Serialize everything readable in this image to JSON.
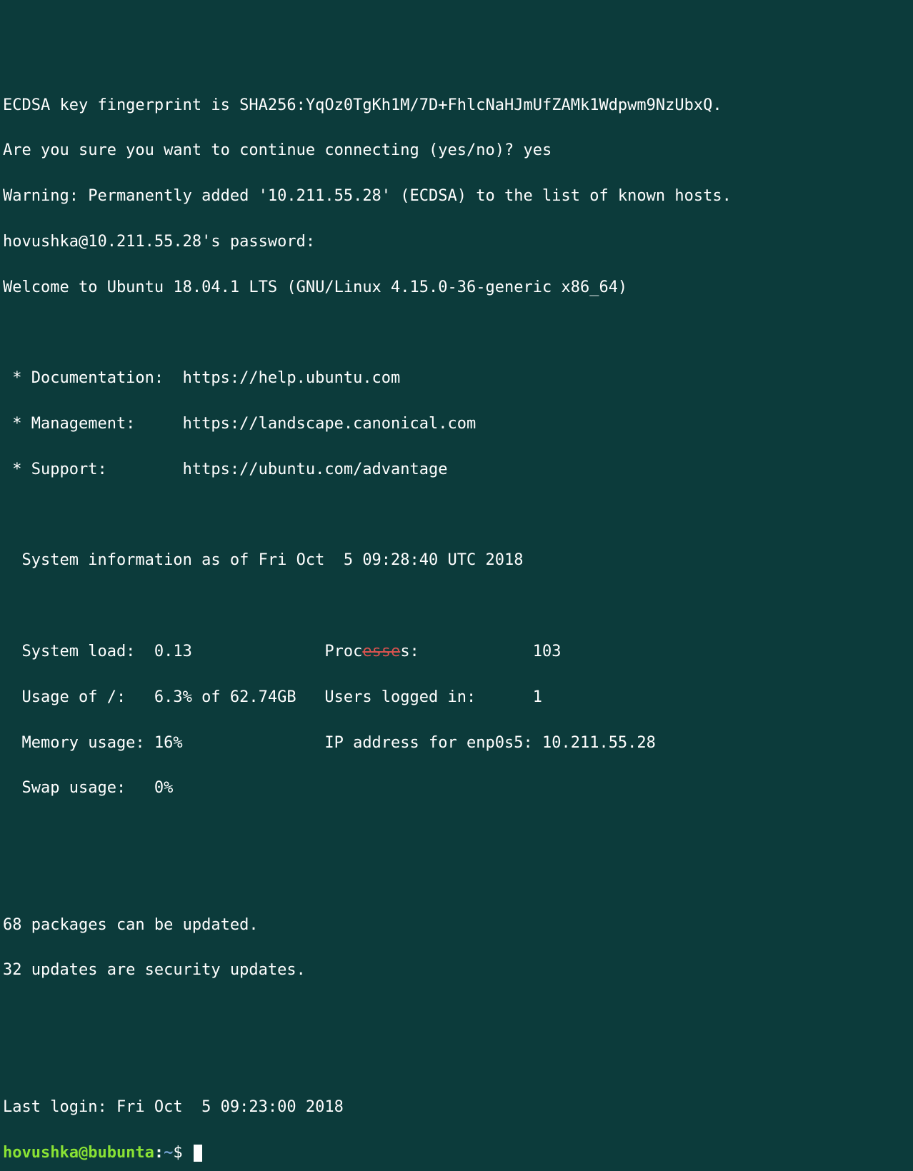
{
  "lines": {
    "ecdsa": "ECDSA key fingerprint is SHA256:YqOz0TgKh1M/7D+FhlcNaHJmUfZAMk1Wdpwm9NzUbxQ.",
    "confirm": "Are you sure you want to continue connecting (yes/no)? yes",
    "warning": "Warning: Permanently added '10.211.55.28' (ECDSA) to the list of known hosts.",
    "password": "hovushka@10.211.55.28's password:",
    "welcome": "Welcome to Ubuntu 18.04.1 LTS (GNU/Linux 4.15.0-36-generic x86_64)"
  },
  "motd": {
    "doc": " * Documentation:  https://help.ubuntu.com",
    "mgmt": " * Management:     https://landscape.canonical.com",
    "support": " * Support:        https://ubuntu.com/advantage"
  },
  "sysinfo_header": "  System information as of Fri Oct  5 09:28:40 UTC 2018",
  "sysinfo": {
    "left1": "  System load:  0.13              ",
    "right1a": "Proc",
    "right1_strike": "esse",
    "right1b": "s:            103",
    "row2": "  Usage of /:   6.3% of 62.74GB   Users logged in:      1",
    "row3": "  Memory usage: 16%               IP address for enp0s5: 10.211.55.28",
    "row4": "  Swap usage:   0%"
  },
  "updates": {
    "l1": "68 packages can be updated.",
    "l2": "32 updates are security updates."
  },
  "lastlogin": "Last login: Fri Oct  5 09:23:00 2018",
  "prompt": {
    "userhost": "hovushka@bubunta",
    "colon": ":",
    "path": "~",
    "dollar": "$ "
  }
}
